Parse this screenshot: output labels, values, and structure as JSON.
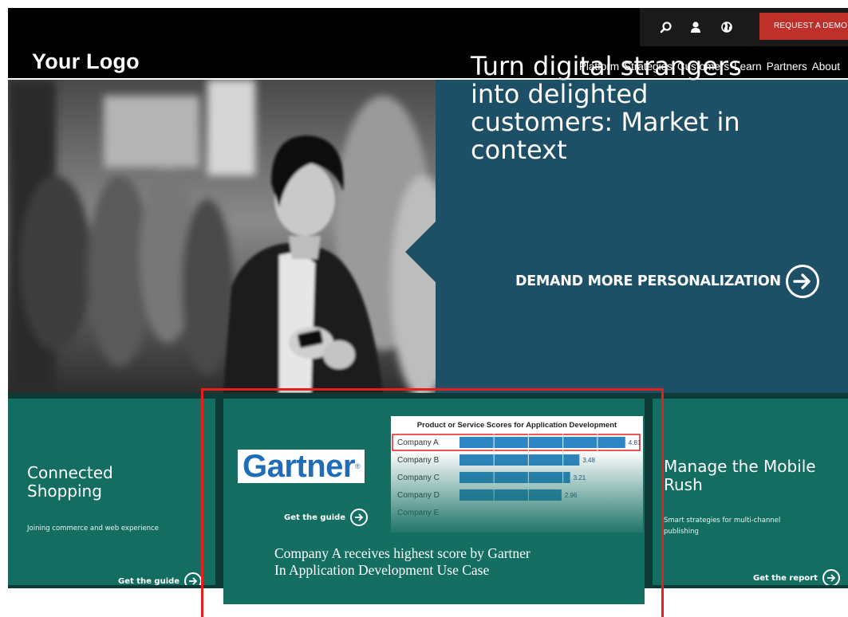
{
  "header": {
    "logo": "Your Logo",
    "utility": {
      "search_icon": "search-icon",
      "user_icon": "user-icon",
      "globe_icon": "globe-icon",
      "demo_button": "REQUEST A DEMO"
    },
    "nav": [
      {
        "label": "Platform"
      },
      {
        "label": "Strategies"
      },
      {
        "label": "Customers"
      },
      {
        "label": "Learn"
      },
      {
        "label": "Partners"
      },
      {
        "label": "About"
      }
    ]
  },
  "hero": {
    "title": "Turn digital strangers into delighted customers: Market in context",
    "cta_label": "DEMAND MORE PERSONALIZATION",
    "cta_icon": "arrow-right-circle-icon"
  },
  "tiles": {
    "left": {
      "heading_line1": "Connected",
      "heading_line2": "Shopping",
      "description": "Joining commerce and web experience",
      "link": "Get the guide"
    },
    "middle": {
      "logo_text": "Gartner",
      "link": "Get the guide",
      "caption_line1": "Company A receives highest score by Gartner",
      "caption_line2": "In Application Development Use Case"
    },
    "right": {
      "heading_line1": "Manage the Mobile",
      "heading_line2": "Rush",
      "description_line1": "Smart strategies for multi-channel",
      "description_line2": "publishing",
      "link": "Get the report"
    }
  },
  "chart_data": {
    "type": "bar",
    "title": "Product or Service Scores for Application Development",
    "categories": [
      "Company A",
      "Company B",
      "Company C",
      "Company D",
      "Company E"
    ],
    "values": [
      4.81,
      3.48,
      3.21,
      2.96,
      null
    ],
    "value_labels": [
      "4.81",
      "3.48",
      "3.21",
      "2.96",
      ""
    ],
    "xlim": [
      0,
      5
    ],
    "highlighted_category": "Company A",
    "bar_color": "#2f86c4",
    "grid": true
  },
  "colors": {
    "header_bg": "#000000",
    "demo_button": "#c0302a",
    "hero_panel": "#1d4f66",
    "tile_green": "#136e61",
    "highlight_red": "#e2201c",
    "gartner_blue": "#1f6db8"
  }
}
